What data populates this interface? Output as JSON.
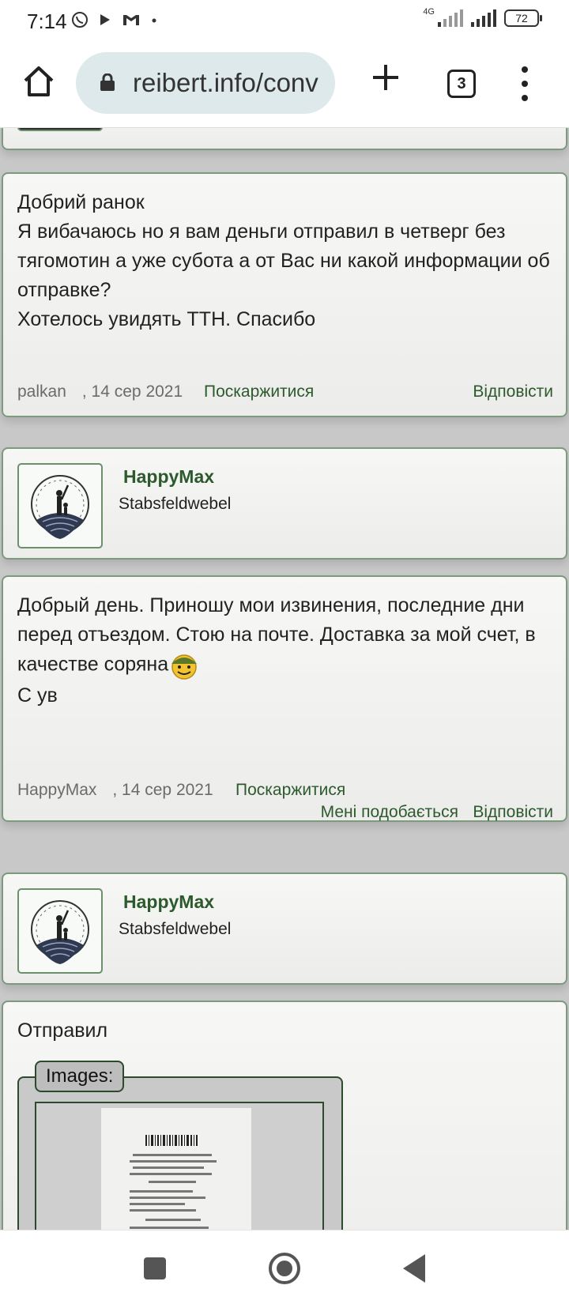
{
  "status_bar": {
    "time": "7:14",
    "network": "4G",
    "battery": "72",
    "icons": [
      "viber-icon",
      "play-icon",
      "gmail-icon",
      "dot-icon"
    ]
  },
  "browser": {
    "url": "reibert.info/conv",
    "tab_count": "3"
  },
  "posts": [
    {
      "text_lines": [
        "Добрий ранок",
        "Я вибачаюсь но я вам деньги отправил в четверг без тягомотин а уже субота а от Вас ни какой информации об отправке?",
        "Хотелось увидять ТТН. Спасибо"
      ],
      "author": "palkan",
      "date": ", 14 сер 2021",
      "report": "Поскаржитися",
      "reply": "Відповісти"
    },
    {
      "user": {
        "name": "HappyMax",
        "rank": "Stabsfeldwebel"
      },
      "text_lines": [
        "Добрый день. Приношу мои извинения, последние дни перед отъездом. Стою на почте. Доставка за мой счет, в качестве соряна",
        "С ув"
      ],
      "author": "HappyMax",
      "date": ", 14 сер 2021",
      "report": "Поскаржитися",
      "like": "Мені подобається",
      "reply": "Відповісти"
    },
    {
      "user": {
        "name": "HappyMax",
        "rank": "Stabsfeldwebel"
      },
      "text_lines": [
        "Отправил"
      ],
      "images_label": "Images:"
    }
  ],
  "colors": {
    "accent_green": "#2d5a2d",
    "card_border": "#7d9a7e",
    "url_pill": "#dde9ea"
  }
}
